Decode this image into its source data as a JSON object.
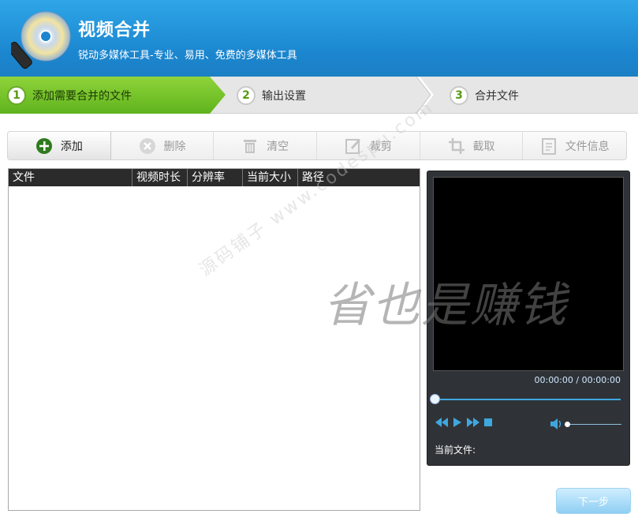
{
  "header": {
    "title": "视频合并",
    "subtitle": "锐动多媒体工具-专业、易用、免费的多媒体工具"
  },
  "steps": [
    {
      "num": "1",
      "label": "添加需要合并的文件"
    },
    {
      "num": "2",
      "label": "输出设置"
    },
    {
      "num": "3",
      "label": "合并文件"
    }
  ],
  "toolbar": {
    "add": "添加",
    "delete": "删除",
    "clear": "清空",
    "trim": "裁剪",
    "crop": "截取",
    "info": "文件信息"
  },
  "columns": [
    "文件",
    "视频时长",
    "分辨率",
    "当前大小",
    "路径"
  ],
  "player": {
    "time": "00:00:00 / 00:00:00",
    "current_file_label": "当前文件:"
  },
  "next_label": "下一步",
  "watermark": {
    "main": "省也是赚钱",
    "diagonal": "源码铺子 www.codespu.com"
  },
  "colors": {
    "header": "#1b86cf",
    "step_active": "#6fc02a",
    "player_bg": "#2f3337",
    "accent": "#3fa7e0"
  }
}
